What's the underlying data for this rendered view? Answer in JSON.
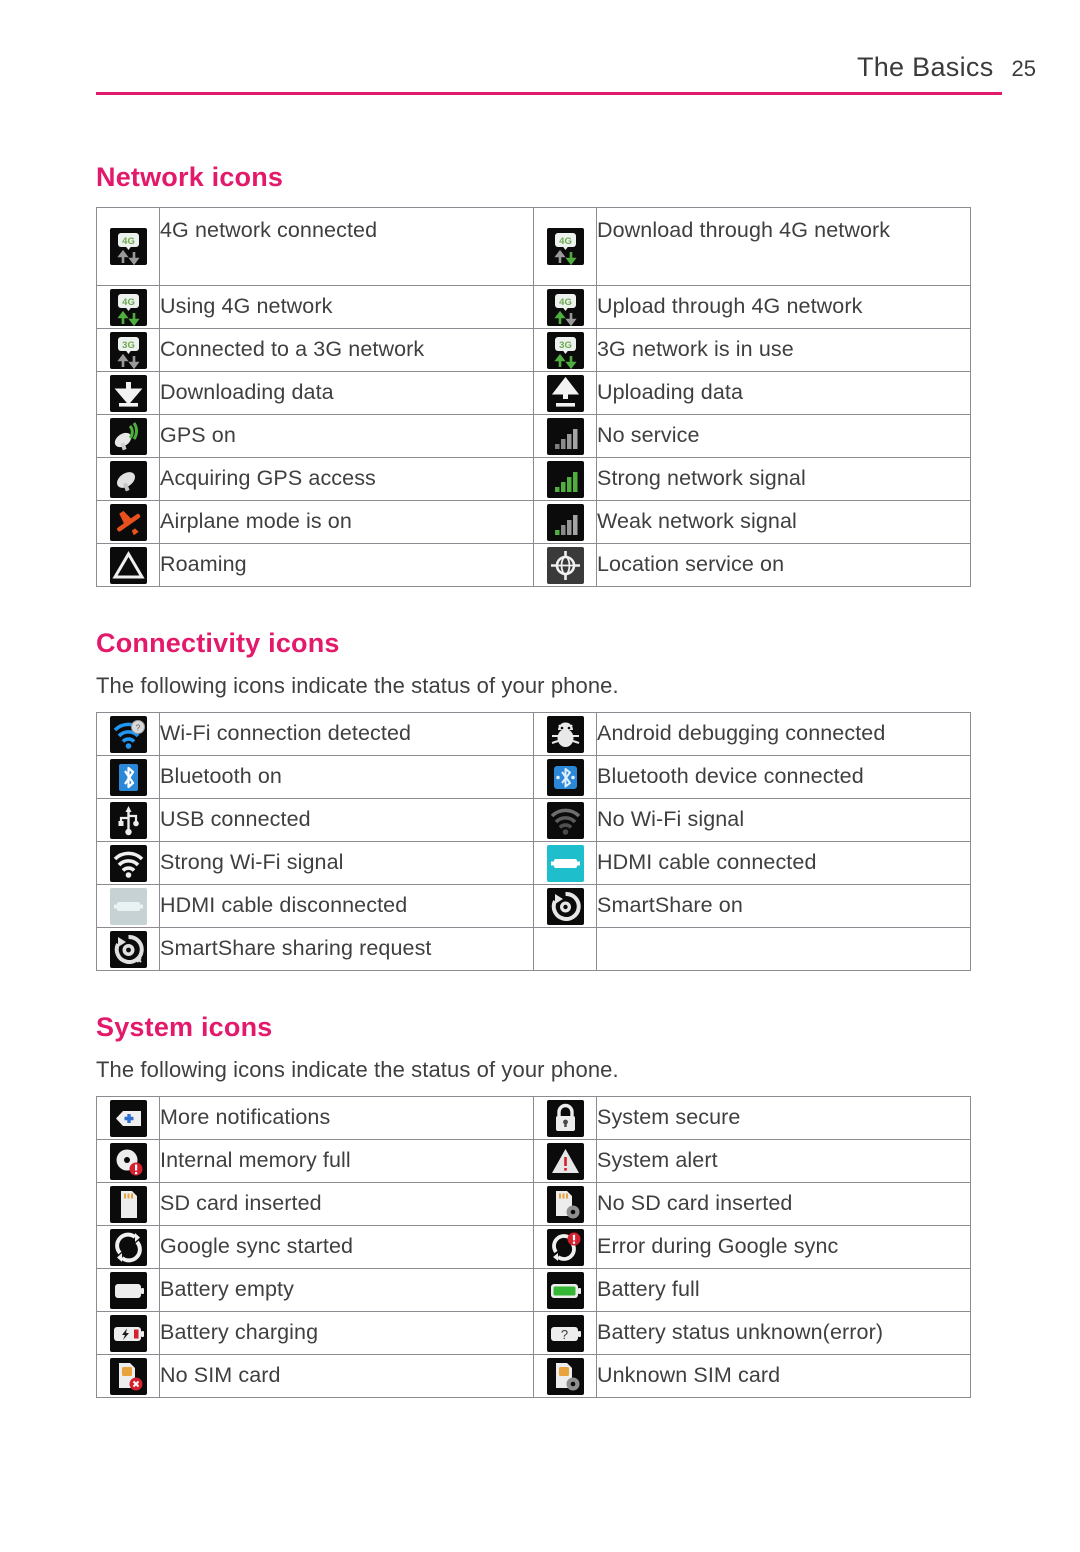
{
  "header": {
    "title": "The Basics",
    "page_number": "25"
  },
  "accent_color": "#e3196b",
  "sections": [
    {
      "id": "network",
      "title": "Network icons",
      "intro": null,
      "rows": [
        {
          "left": {
            "icon": "4g-connected-icon",
            "label": "4G network connected"
          },
          "right": {
            "icon": "4g-download-icon",
            "label": "Download through 4G network"
          },
          "tall": true
        },
        {
          "left": {
            "icon": "4g-in-use-icon",
            "label": "Using 4G network"
          },
          "right": {
            "icon": "4g-upload-icon",
            "label": "Upload through 4G network"
          }
        },
        {
          "left": {
            "icon": "3g-connected-icon",
            "label": "Connected to a 3G network"
          },
          "right": {
            "icon": "3g-in-use-icon",
            "label": "3G network is in use"
          }
        },
        {
          "left": {
            "icon": "download-data-icon",
            "label": "Downloading data"
          },
          "right": {
            "icon": "upload-data-icon",
            "label": "Uploading data"
          }
        },
        {
          "left": {
            "icon": "gps-on-icon",
            "label": "GPS on"
          },
          "right": {
            "icon": "no-service-icon",
            "label": "No service"
          }
        },
        {
          "left": {
            "icon": "gps-acquiring-icon",
            "label": "Acquiring GPS access"
          },
          "right": {
            "icon": "signal-strong-icon",
            "label": "Strong network signal"
          }
        },
        {
          "left": {
            "icon": "airplane-mode-icon",
            "label": "Airplane mode is on"
          },
          "right": {
            "icon": "signal-weak-icon",
            "label": "Weak network signal"
          }
        },
        {
          "left": {
            "icon": "roaming-icon",
            "label": "Roaming"
          },
          "right": {
            "icon": "location-service-icon",
            "label": "Location service on"
          }
        }
      ]
    },
    {
      "id": "connectivity",
      "title": "Connectivity icons",
      "intro": "The following icons indicate the status of your phone.",
      "rows": [
        {
          "left": {
            "icon": "wifi-detected-icon",
            "label": "Wi-Fi connection detected"
          },
          "right": {
            "icon": "android-debug-icon",
            "label": "Android debugging connected"
          }
        },
        {
          "left": {
            "icon": "bluetooth-on-icon",
            "label": "Bluetooth on"
          },
          "right": {
            "icon": "bluetooth-connected-icon",
            "label": "Bluetooth device connected"
          }
        },
        {
          "left": {
            "icon": "usb-connected-icon",
            "label": "USB connected"
          },
          "right": {
            "icon": "wifi-none-icon",
            "label": "No Wi-Fi signal"
          }
        },
        {
          "left": {
            "icon": "wifi-strong-icon",
            "label": "Strong Wi-Fi signal"
          },
          "right": {
            "icon": "hdmi-connected-icon",
            "label": "HDMI cable connected"
          }
        },
        {
          "left": {
            "icon": "hdmi-disconnected-icon",
            "label": "HDMI cable disconnected"
          },
          "right": {
            "icon": "smartshare-on-icon",
            "label": "SmartShare on"
          }
        },
        {
          "left": {
            "icon": "smartshare-request-icon",
            "label": "SmartShare sharing request"
          },
          "right": {
            "icon": null,
            "label": ""
          }
        }
      ]
    },
    {
      "id": "system",
      "title": "System icons",
      "intro": "The following icons indicate the status of your phone.",
      "rows": [
        {
          "left": {
            "icon": "more-notifications-icon",
            "label": "More notifications"
          },
          "right": {
            "icon": "system-secure-icon",
            "label": "System secure"
          }
        },
        {
          "left": {
            "icon": "memory-full-icon",
            "label": "Internal memory full"
          },
          "right": {
            "icon": "system-alert-icon",
            "label": "System alert"
          }
        },
        {
          "left": {
            "icon": "sd-card-inserted-icon",
            "label": "SD card inserted"
          },
          "right": {
            "icon": "sd-card-missing-icon",
            "label": "No SD card inserted"
          }
        },
        {
          "left": {
            "icon": "sync-started-icon",
            "label": "Google sync started"
          },
          "right": {
            "icon": "sync-error-icon",
            "label": "Error during Google sync"
          }
        },
        {
          "left": {
            "icon": "battery-empty-icon",
            "label": "Battery empty"
          },
          "right": {
            "icon": "battery-full-icon",
            "label": "Battery full"
          }
        },
        {
          "left": {
            "icon": "battery-charging-icon",
            "label": "Battery charging"
          },
          "right": {
            "icon": "battery-unknown-icon",
            "label": "Battery status unknown(error)"
          }
        },
        {
          "left": {
            "icon": "no-sim-card-icon",
            "label": "No SIM card"
          },
          "right": {
            "icon": "unknown-sim-card-icon",
            "label": "Unknown SIM card"
          }
        }
      ]
    }
  ]
}
